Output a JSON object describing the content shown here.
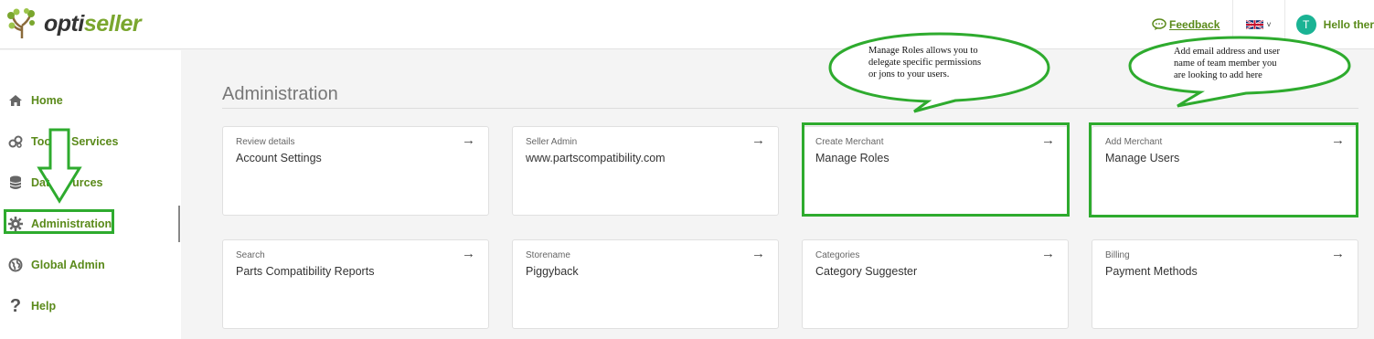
{
  "header": {
    "logo_opti": "opti",
    "logo_seller": "seller",
    "feedback_label": "Feedback",
    "language_flag": "uk-flag-icon",
    "avatar_letter": "T",
    "greeting": "Hello ther"
  },
  "sidebar": {
    "items": [
      {
        "label": "Home",
        "icon": "home-icon"
      },
      {
        "label": "Tools & Services",
        "icon": "tools-icon"
      },
      {
        "label": "Data Sources",
        "icon": "database-icon"
      },
      {
        "label": "Administration",
        "icon": "gear-icon"
      },
      {
        "label": "Global Admin",
        "icon": "globe-icon"
      },
      {
        "label": "Help",
        "icon": "question-icon"
      }
    ],
    "items_visible": {
      "tools_left": "Too",
      "tools_right": "Services",
      "data_left": "Dat",
      "data_right": "urces"
    }
  },
  "main": {
    "title": "Administration",
    "cards": [
      {
        "small": "Review details",
        "big": "Account Settings"
      },
      {
        "small": "Seller Admin",
        "big": "www.partscompatibility.com"
      },
      {
        "small": "Create Merchant",
        "big": "Manage Roles"
      },
      {
        "small": "Add Merchant",
        "big": "Manage Users"
      },
      {
        "small": "Search",
        "big": "Parts Compatibility Reports"
      },
      {
        "small": "Storename",
        "big": "Piggyback"
      },
      {
        "small": "Categories",
        "big": "Category Suggester"
      },
      {
        "small": "Billing",
        "big": "Payment Methods"
      }
    ]
  },
  "annotations": {
    "roles_bubble": [
      "Manage Roles allows you to",
      "delegate specific permissions",
      "or jons to your users."
    ],
    "users_bubble": [
      "Add email address and user",
      "name of team member you",
      "are looking to add here"
    ]
  },
  "colors": {
    "brand_green": "#7aa62e",
    "link_green": "#5a8a1a",
    "highlight_green": "#2eab2e",
    "avatar_teal": "#1ab394"
  }
}
